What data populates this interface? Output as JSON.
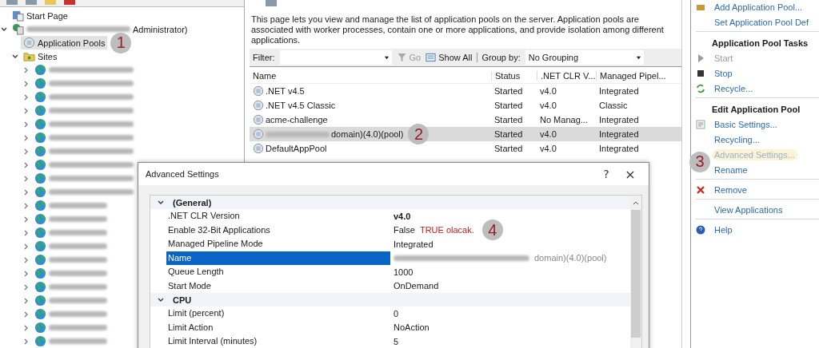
{
  "tree": [
    {
      "label": "Start Page",
      "kind": "start",
      "selected": false
    },
    {
      "label": "Administrator)",
      "kind": "server",
      "redacted_prefix": true,
      "expanded": true,
      "selected": false,
      "children": [
        {
          "label": "Application Pools",
          "kind": "pools",
          "selected": true,
          "annotation": "1"
        },
        {
          "label": "Sites",
          "kind": "folder",
          "expanded": true,
          "selected": false,
          "children": [
            {
              "kind": "site",
              "expanded": false,
              "selected": false
            },
            {
              "kind": "site",
              "expanded": false,
              "selected": false
            },
            {
              "kind": "site",
              "expanded": false,
              "selected": false
            },
            {
              "kind": "site",
              "expanded": false,
              "selected": false
            },
            {
              "kind": "site",
              "expanded": false,
              "selected": false
            },
            {
              "kind": "site",
              "expanded": false,
              "selected": false
            },
            {
              "kind": "site",
              "expanded": false,
              "selected": false
            },
            {
              "kind": "site",
              "expanded": false,
              "selected": false
            },
            {
              "kind": "site",
              "expanded": false,
              "selected": false
            },
            {
              "kind": "site",
              "expanded": false,
              "selected": false
            },
            {
              "kind": "site",
              "expanded": false,
              "selected": false
            },
            {
              "kind": "site",
              "expanded": false,
              "selected": false
            },
            {
              "kind": "site",
              "expanded": false,
              "selected": false
            },
            {
              "kind": "site",
              "expanded": false,
              "selected": false
            },
            {
              "kind": "site",
              "expanded": false,
              "selected": false
            },
            {
              "kind": "site",
              "expanded": false,
              "selected": false
            },
            {
              "kind": "site",
              "expanded": false,
              "selected": false
            },
            {
              "kind": "site",
              "expanded": false,
              "selected": false
            },
            {
              "kind": "site",
              "expanded": false,
              "selected": false
            },
            {
              "kind": "site",
              "expanded": false,
              "selected": false
            },
            {
              "kind": "site",
              "expanded": false,
              "selected": false
            }
          ]
        }
      ]
    }
  ],
  "pools_page": {
    "description": "This page lets you view and manage the list of application pools on the server. Application pools are associated with worker processes, contain one or more applications, and provide isolation among different applications.",
    "filter": {
      "label": "Filter:",
      "go": "Go",
      "show_all": "Show All",
      "group_by_label": "Group by:",
      "group_by_value": "No Grouping"
    },
    "columns": [
      "Name",
      "Status",
      ".NET CLR V...",
      "Managed Pipel..."
    ],
    "rows": [
      {
        "name": ".NET v4.5",
        "status": "Started",
        "clr": "v4.0",
        "pipeline": "Integrated",
        "selected": false
      },
      {
        "name": ".NET v4.5 Classic",
        "status": "Started",
        "clr": "v4.0",
        "pipeline": "Classic",
        "selected": false
      },
      {
        "name": "acme-challenge",
        "status": "Started",
        "clr": "No Manag...",
        "pipeline": "Integrated",
        "selected": false
      },
      {
        "name": "domain)(4.0)(pool)",
        "redacted_prefix": true,
        "annotation": "2",
        "status": "Started",
        "clr": "v4.0",
        "pipeline": "Integrated",
        "selected": true
      },
      {
        "name": "DefaultAppPool",
        "status": "Started",
        "clr": "v4.0",
        "pipeline": "Integrated",
        "selected": false
      }
    ]
  },
  "actions": [
    {
      "items": [
        {
          "label": "Add Application Pool...",
          "kind": "add",
          "disabled": false,
          "highlighted": false
        },
        {
          "label": "Set Application Pool Def",
          "disabled": false,
          "highlighted": false
        }
      ]
    },
    {
      "heading": "Application Pool Tasks",
      "items": [
        {
          "label": "Start",
          "kind": "start",
          "disabled": true,
          "highlighted": false
        },
        {
          "label": "Stop",
          "kind": "stop",
          "disabled": false,
          "highlighted": false
        },
        {
          "label": "Recycle...",
          "kind": "recycle",
          "disabled": false,
          "highlighted": false
        }
      ]
    },
    {
      "heading": "Edit Application Pool",
      "items": [
        {
          "label": "Basic Settings...",
          "kind": "settings",
          "disabled": false,
          "highlighted": false
        },
        {
          "label": "Recycling...",
          "disabled": false,
          "highlighted": false
        },
        {
          "label": "Advanced Settings...",
          "annotation": "3",
          "disabled": false,
          "highlighted": true
        },
        {
          "label": "Rename",
          "disabled": false,
          "highlighted": false
        }
      ]
    },
    {
      "items": [
        {
          "label": "Remove",
          "kind": "remove",
          "disabled": false,
          "highlighted": false
        }
      ]
    },
    {
      "items": [
        {
          "label": "View Applications",
          "disabled": false,
          "highlighted": false
        }
      ]
    },
    {
      "items": [
        {
          "label": "Help",
          "kind": "help",
          "disabled": false,
          "highlighted": false
        }
      ]
    }
  ],
  "dialog": {
    "title": "Advanced Settings",
    "help": "?",
    "close": "×",
    "categories": [
      {
        "name": "(General)",
        "expanded": true,
        "properties": [
          {
            "name": ".NET CLR Version",
            "value": "v4.0",
            "emphasized": true,
            "selected": false
          },
          {
            "name": "Enable 32-Bit Applications",
            "value": "False",
            "note": "TRUE olacak.",
            "annotation": "4",
            "emphasized": false,
            "selected": false
          },
          {
            "name": "Managed Pipeline Mode",
            "value": "Integrated",
            "emphasized": false,
            "selected": false
          },
          {
            "name": "Name",
            "value": "domain)(4.0)(pool)",
            "redacted_prefix": true,
            "emphasized": false,
            "selected": true
          },
          {
            "name": "Queue Length",
            "value": "1000",
            "emphasized": false,
            "selected": false
          },
          {
            "name": "Start Mode",
            "value": "OnDemand",
            "emphasized": false,
            "selected": false
          }
        ]
      },
      {
        "name": "CPU",
        "expanded": true,
        "properties": [
          {
            "name": "Limit (percent)",
            "value": "0",
            "emphasized": false,
            "selected": false
          },
          {
            "name": "Limit Action",
            "value": "NoAction",
            "emphasized": false,
            "selected": false
          },
          {
            "name": "Limit Interval (minutes)",
            "value": "5",
            "emphasized": false,
            "selected": false
          }
        ]
      }
    ]
  }
}
